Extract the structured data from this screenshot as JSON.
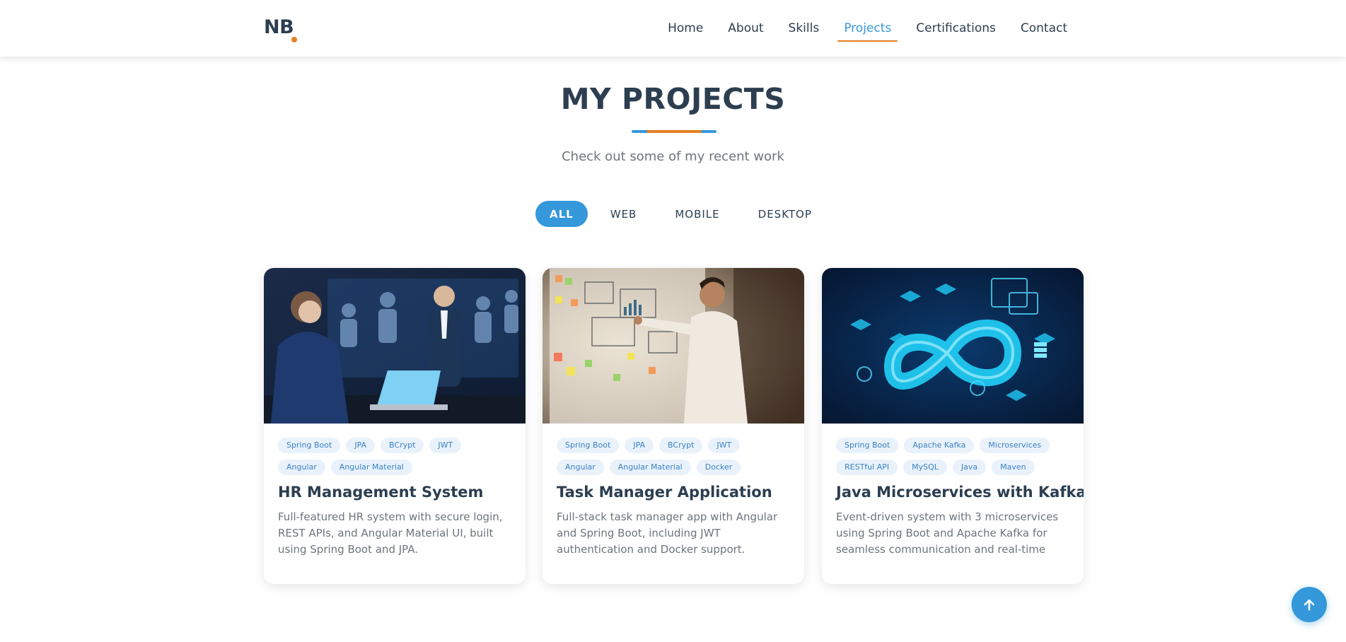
{
  "logo": {
    "text": "NB",
    "accent_color": "#e67e22"
  },
  "nav": {
    "items": [
      {
        "label": "Home"
      },
      {
        "label": "About"
      },
      {
        "label": "Skills"
      },
      {
        "label": "Projects",
        "active": true
      },
      {
        "label": "Certifications"
      },
      {
        "label": "Contact"
      }
    ]
  },
  "section": {
    "title": "MY PROJECTS",
    "subtitle": "Check out some of my recent work"
  },
  "filters": [
    {
      "label": "ALL",
      "active": true
    },
    {
      "label": "WEB"
    },
    {
      "label": "MOBILE"
    },
    {
      "label": "DESKTOP"
    }
  ],
  "projects": [
    {
      "image": "hr-meeting-illustration",
      "tags": [
        "Spring Boot",
        "JPA",
        "BCrypt",
        "JWT",
        "Angular",
        "Angular Material"
      ],
      "title": "HR Management System",
      "description": "Full-featured HR system with secure login, REST APIs, and Angular Material UI, built using Spring Boot and JPA."
    },
    {
      "image": "whiteboard-planning-illustration",
      "tags": [
        "Spring Boot",
        "JPA",
        "BCrypt",
        "JWT",
        "Angular",
        "Angular Material",
        "Docker"
      ],
      "title": "Task Manager Application",
      "description": "Full-stack task manager app with Angular and Spring Boot, including JWT authentication and Docker support."
    },
    {
      "image": "infinity-loop-devops-illustration",
      "tags": [
        "Spring Boot",
        "Apache Kafka",
        "Microservices",
        "RESTful API",
        "MySQL",
        "Java",
        "Maven"
      ],
      "title": "Java Microservices with Kafka",
      "description": "Event-driven system with 3 microservices using Spring Boot and Apache Kafka for seamless communication and real-time dat..."
    }
  ],
  "scroll_top": {
    "icon": "arrow-up-icon"
  },
  "colors": {
    "primary": "#3498db",
    "accent": "#e67e22",
    "text": "#2c3e50",
    "muted": "#6c757d"
  }
}
